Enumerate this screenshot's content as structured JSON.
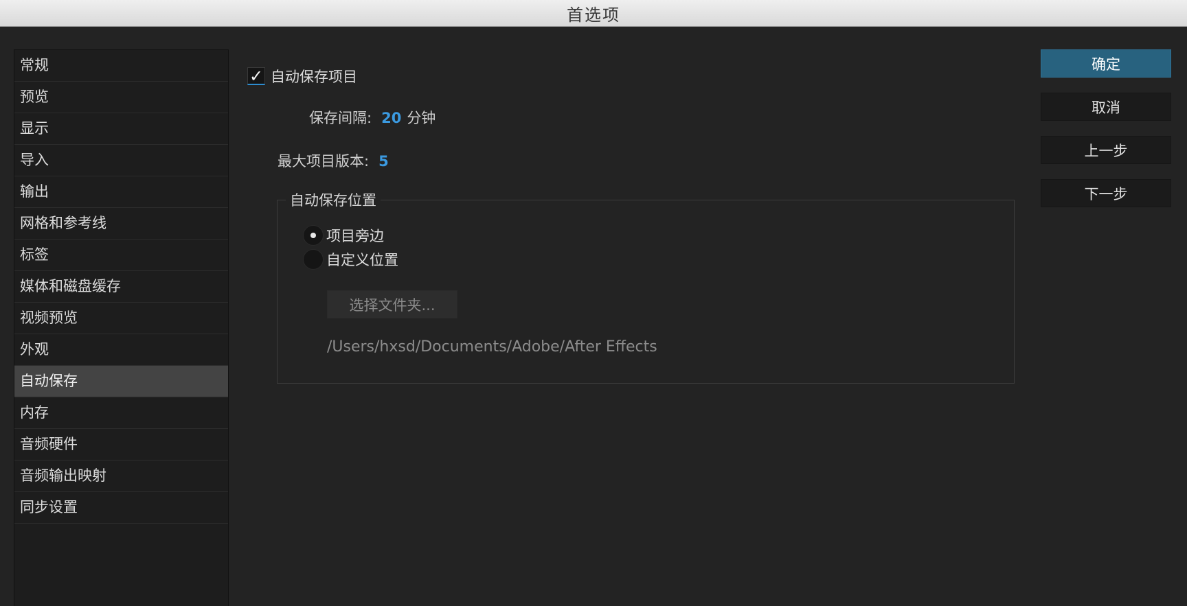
{
  "window": {
    "title": "首选项"
  },
  "sidebar": {
    "items": [
      {
        "label": "常规"
      },
      {
        "label": "预览"
      },
      {
        "label": "显示"
      },
      {
        "label": "导入"
      },
      {
        "label": "输出"
      },
      {
        "label": "网格和参考线"
      },
      {
        "label": "标签"
      },
      {
        "label": "媒体和磁盘缓存"
      },
      {
        "label": "视频预览"
      },
      {
        "label": "外观"
      },
      {
        "label": "自动保存",
        "selected": true
      },
      {
        "label": "内存"
      },
      {
        "label": "音频硬件"
      },
      {
        "label": "音频输出映射"
      },
      {
        "label": "同步设置"
      }
    ]
  },
  "autosave": {
    "checkbox_label": "自动保存项目",
    "checked": true,
    "interval_label": "保存间隔:",
    "interval_value": "20",
    "interval_unit": "分钟",
    "max_versions_label": "最大项目版本:",
    "max_versions_value": "5"
  },
  "location": {
    "group_title": "自动保存位置",
    "options": [
      {
        "label": "项目旁边",
        "selected": true
      },
      {
        "label": "自定义位置",
        "selected": false
      }
    ],
    "choose_folder_label": "选择文件夹...",
    "path": "/Users/hxsd/Documents/Adobe/After Effects"
  },
  "buttons": {
    "ok": "确定",
    "cancel": "取消",
    "prev": "上一步",
    "next": "下一步"
  },
  "colors": {
    "accent_value": "#3b9ae0",
    "primary_button": "#28627f",
    "background": "#232323"
  }
}
